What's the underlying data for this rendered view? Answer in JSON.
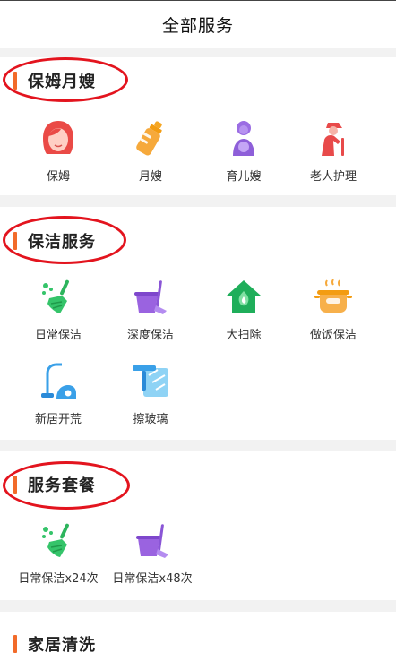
{
  "header": {
    "title": "全部服务"
  },
  "sections": [
    {
      "title": "保姆月嫂",
      "items": [
        {
          "label": "保姆",
          "icon": "nanny-icon"
        },
        {
          "label": "月嫂",
          "icon": "baby-bottle-icon"
        },
        {
          "label": "育儿嫂",
          "icon": "childcare-icon"
        },
        {
          "label": "老人护理",
          "icon": "elderly-care-icon"
        }
      ]
    },
    {
      "title": "保洁服务",
      "items": [
        {
          "label": "日常保洁",
          "icon": "broom-icon"
        },
        {
          "label": "深度保洁",
          "icon": "mop-bucket-icon"
        },
        {
          "label": "大扫除",
          "icon": "house-icon"
        },
        {
          "label": "做饭保洁",
          "icon": "cooking-pot-icon"
        },
        {
          "label": "新居开荒",
          "icon": "vacuum-icon"
        },
        {
          "label": "擦玻璃",
          "icon": "window-wiper-icon"
        }
      ]
    },
    {
      "title": "服务套餐",
      "items": [
        {
          "label": "日常保洁x24次",
          "icon": "broom-icon"
        },
        {
          "label": "日常保洁x48次",
          "icon": "mop-bucket-icon"
        }
      ]
    },
    {
      "title": "家居清洗",
      "items": []
    }
  ],
  "colors": {
    "accent": "#f26b2a",
    "annotation": "#e3141e"
  }
}
